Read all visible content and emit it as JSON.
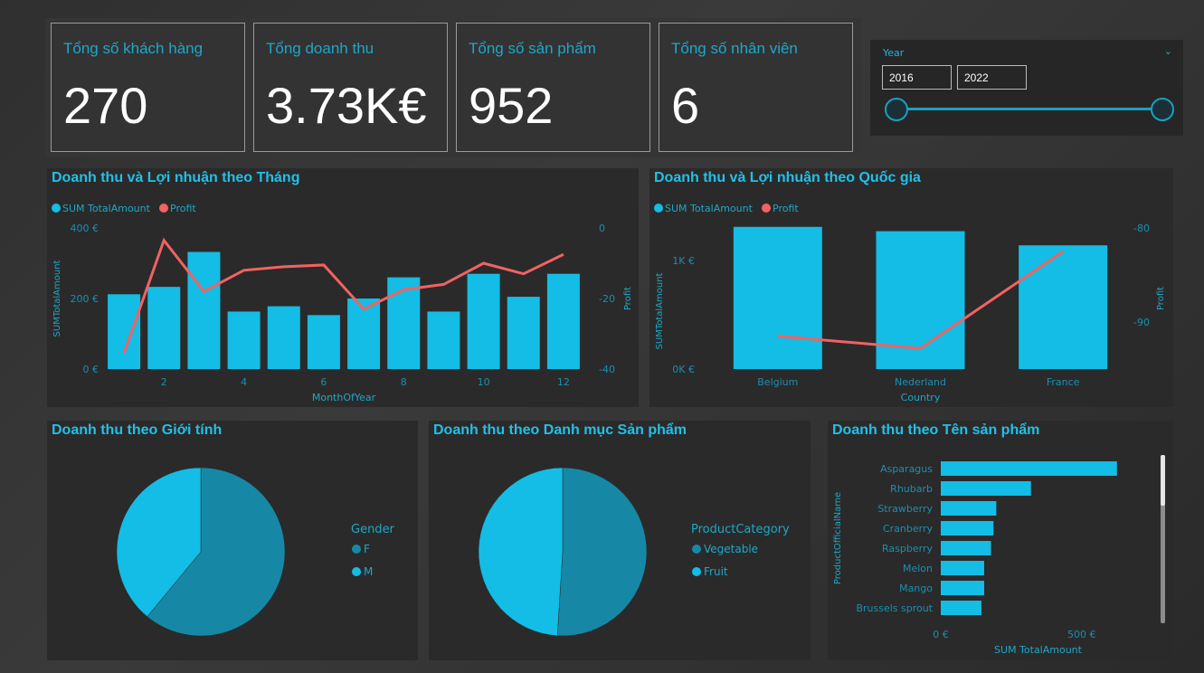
{
  "kpis": [
    {
      "label": "Tổng số khách hàng",
      "value": "270"
    },
    {
      "label": "Tổng doanh thu",
      "value": "3.73K€"
    },
    {
      "label": "Tổng số sản phẩm",
      "value": "952"
    },
    {
      "label": "Tổng số nhân viên",
      "value": "6"
    }
  ],
  "slicer": {
    "title": "Year",
    "from": "2016",
    "to": "2022"
  },
  "colors": {
    "bar": "#13bde5",
    "line": "#f26262",
    "pie_dark": "#1688a6",
    "pie_light": "#13bde5"
  },
  "chart_data": [
    {
      "type": "bar",
      "title": "Doanh thu và Lợi nhuận theo Tháng",
      "legend": [
        "SUM TotalAmount",
        "Profit"
      ],
      "xlabel": "MonthOfYear",
      "ylabel": "SUMTotalAmount",
      "y2label": "Profit",
      "x": [
        1,
        2,
        3,
        4,
        5,
        6,
        7,
        8,
        9,
        10,
        11,
        12
      ],
      "xticks": [
        "2",
        "4",
        "6",
        "8",
        "10",
        "12"
      ],
      "yticks": [
        "400 €",
        "200 €",
        "0 €"
      ],
      "y2ticks": [
        "0",
        "-20",
        "-40"
      ],
      "ylim": [
        0,
        400
      ],
      "y2lim": [
        -40,
        0
      ],
      "series": [
        {
          "name": "SUM TotalAmount",
          "values": [
            212,
            233,
            332,
            163,
            178,
            153,
            200,
            260,
            163,
            270,
            205,
            270
          ]
        },
        {
          "name": "Profit",
          "values": [
            -35.5,
            -3.5,
            -18,
            -12,
            -11,
            -10.5,
            -23,
            -17.5,
            -16,
            -10,
            -13,
            -7.5
          ]
        }
      ]
    },
    {
      "type": "bar",
      "title": "Doanh thu và Lợi nhuận theo Quốc gia",
      "legend": [
        "SUM TotalAmount",
        "Profit"
      ],
      "xlabel": "Country",
      "ylabel": "SUMTotalAmount",
      "y2label": "Profit",
      "categories": [
        "Belgium",
        "Nederland",
        "France"
      ],
      "yticks": [
        "1K €",
        "0K €"
      ],
      "y2ticks": [
        "-80",
        "-90"
      ],
      "ylim": [
        0,
        1300
      ],
      "y2lim": [
        -95,
        -80
      ],
      "series": [
        {
          "name": "SUM TotalAmount",
          "values": [
            1310,
            1270,
            1140
          ]
        },
        {
          "name": "Profit",
          "values": [
            -91.5,
            -92.8,
            -82.5
          ]
        }
      ]
    },
    {
      "type": "pie",
      "title": "Doanh thu theo Giới tính",
      "legend_title": "Gender",
      "categories": [
        "F",
        "M"
      ],
      "values": [
        61,
        39
      ]
    },
    {
      "type": "pie",
      "title": "Doanh thu theo Danh mục Sản phẩm",
      "legend_title": "ProductCategory",
      "categories": [
        "Vegetable",
        "Fruit"
      ],
      "values": [
        51,
        49
      ]
    },
    {
      "type": "bar",
      "title": "Doanh thu theo Tên sản phẩm",
      "orientation": "horizontal",
      "xlabel": "SUM TotalAmount",
      "ylabel": "ProductOfficialName",
      "xticks": [
        "0 €",
        "500 €"
      ],
      "xlim": [
        0,
        690
      ],
      "categories": [
        "Asparagus",
        "Rhubarb",
        "Strawberry",
        "Cranberry",
        "Raspberry",
        "Melon",
        "Mango",
        "Brussels sprout"
      ],
      "values": [
        625,
        320,
        197,
        187,
        178,
        154,
        154,
        144
      ]
    }
  ]
}
